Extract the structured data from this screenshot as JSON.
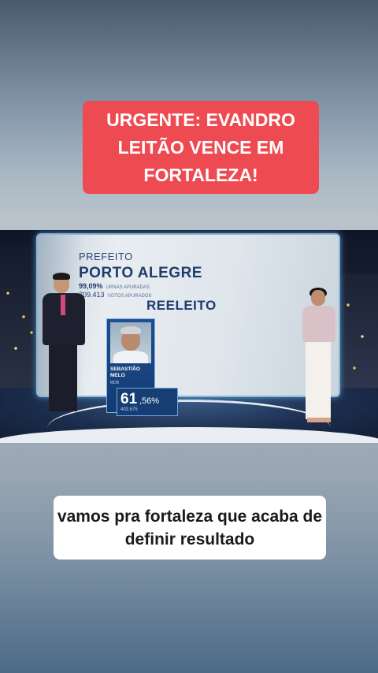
{
  "headline": {
    "text": "URGENTE: EVANDRO LEITÃO VENCE EM FORTALEZA!"
  },
  "broadcast": {
    "office": "PREFEITO",
    "city": "PORTO ALEGRE",
    "urns_pct": "99,09%",
    "urns_label": "URNAS APURADAS",
    "votes_total": "709.413",
    "votes_label": "VOTOS APURADOS",
    "status": "REELEITO",
    "candidate": {
      "name": "SEBASTIÃO MELO",
      "party": "MDB",
      "pct_int": "61",
      "pct_dec": ",56%",
      "votes": "403.675"
    }
  },
  "caption": {
    "text": "vamos pra fortaleza que acaba de definir resultado"
  },
  "colors": {
    "headline_bg": "#ee4a52",
    "caption_bg": "#ffffff",
    "graphic_text": "#1f3c6c"
  }
}
